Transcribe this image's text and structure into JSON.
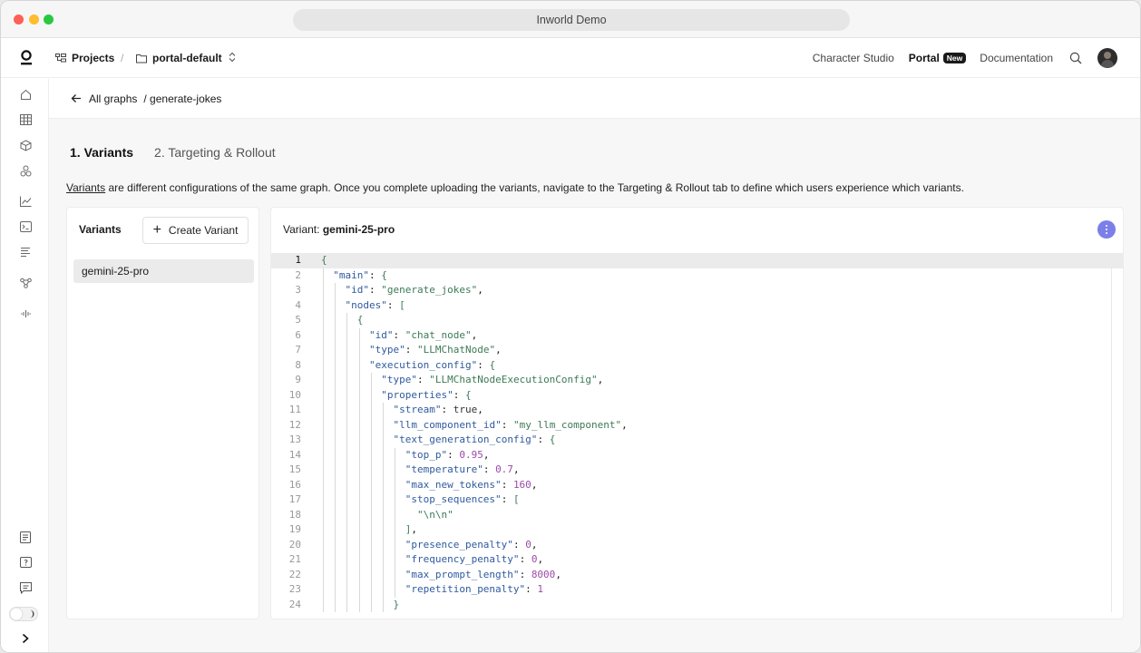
{
  "browser": {
    "title": "Inworld Demo"
  },
  "topnav": {
    "projects": "Projects",
    "separator": "/",
    "project_name": "portal-default",
    "links": [
      "Character Studio",
      "Portal",
      "Documentation"
    ],
    "new_badge": "New"
  },
  "breadcrumb": {
    "back": "All graphs",
    "current": "/ generate-jokes"
  },
  "tabs": [
    "1. Variants",
    "2. Targeting & Rollout"
  ],
  "description": {
    "link": "Variants",
    "text": " are different configurations of the same graph. Once you complete uploading the variants, navigate to the Targeting & Rollout tab to define which users experience which variants."
  },
  "variants_panel": {
    "title": "Variants",
    "create_button": "Create Variant",
    "items": [
      "gemini-25-pro"
    ]
  },
  "editor": {
    "label": "Variant: ",
    "variant_name": "gemini-25-pro",
    "lines": [
      "{",
      "  \"main\": {",
      "    \"id\": \"generate_jokes\",",
      "    \"nodes\": [",
      "      {",
      "        \"id\": \"chat_node\",",
      "        \"type\": \"LLMChatNode\",",
      "        \"execution_config\": {",
      "          \"type\": \"LLMChatNodeExecutionConfig\",",
      "          \"properties\": {",
      "            \"stream\": true,",
      "            \"llm_component_id\": \"my_llm_component\",",
      "            \"text_generation_config\": {",
      "              \"top_p\": 0.95,",
      "              \"temperature\": 0.7,",
      "              \"max_new_tokens\": 160,",
      "              \"stop_sequences\": [",
      "                \"\\n\\n\"",
      "              ],",
      "              \"presence_penalty\": 0,",
      "              \"frequency_penalty\": 0,",
      "              \"max_prompt_length\": 8000,",
      "              \"repetition_penalty\": 1",
      "            }"
    ]
  },
  "colors": {
    "accent": "#7b7fe8",
    "key": "#2f5a9e",
    "string": "#3c7a56",
    "number": "#9b4aa8"
  }
}
